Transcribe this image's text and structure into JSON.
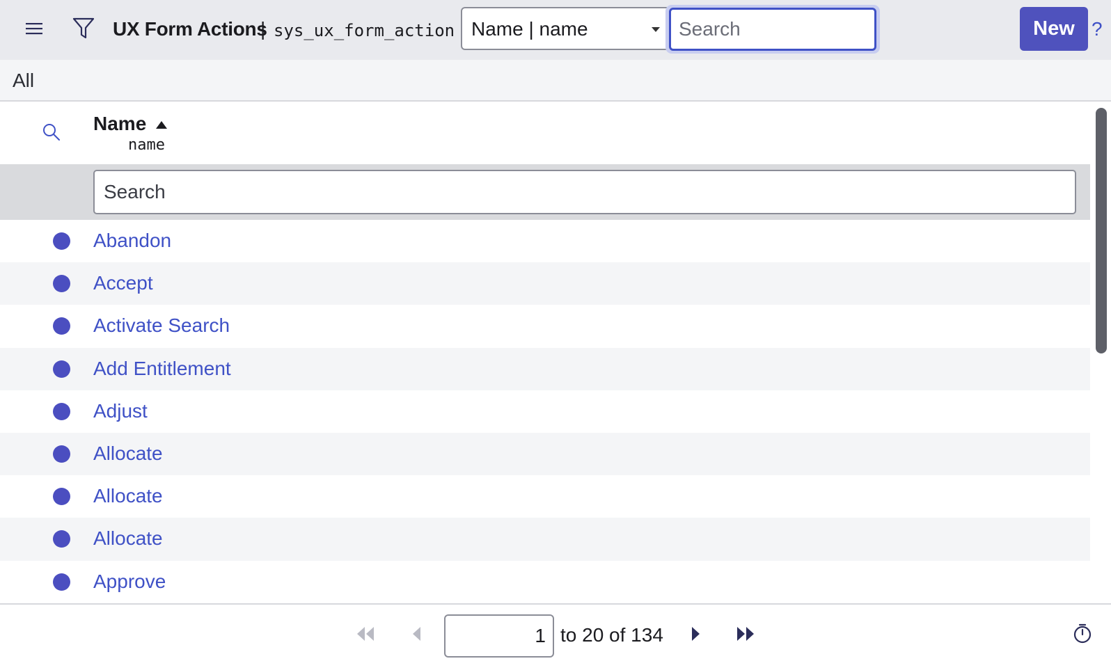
{
  "header": {
    "menu_icon": "hamburger-menu-icon",
    "filter_icon": "funnel-filter-icon",
    "title": "UX Form Actions",
    "separator": "|",
    "table_name": "sys_ux_form_action",
    "field_select": {
      "selected": "Name | name"
    },
    "search": {
      "placeholder": "Search",
      "value": ""
    },
    "new_label": "New",
    "help_label": "?"
  },
  "breadcrumb": {
    "label": "All"
  },
  "columns": [
    {
      "label": "Name",
      "field": "name",
      "sort": "ascending"
    }
  ],
  "column_search": {
    "placeholder": "Search",
    "value": ""
  },
  "rows": [
    {
      "name": "Abandon"
    },
    {
      "name": "Accept"
    },
    {
      "name": "Activate Search"
    },
    {
      "name": "Add Entitlement"
    },
    {
      "name": "Adjust"
    },
    {
      "name": "Allocate"
    },
    {
      "name": "Allocate"
    },
    {
      "name": "Allocate"
    },
    {
      "name": "Approve"
    }
  ],
  "pagination": {
    "current_value": "1",
    "range_label": "to 20 of 134"
  },
  "colors": {
    "accent": "#4f52bd",
    "link": "#3f51c6",
    "header_bg": "#e9eaee",
    "row_alt_bg": "#f4f5f7"
  }
}
